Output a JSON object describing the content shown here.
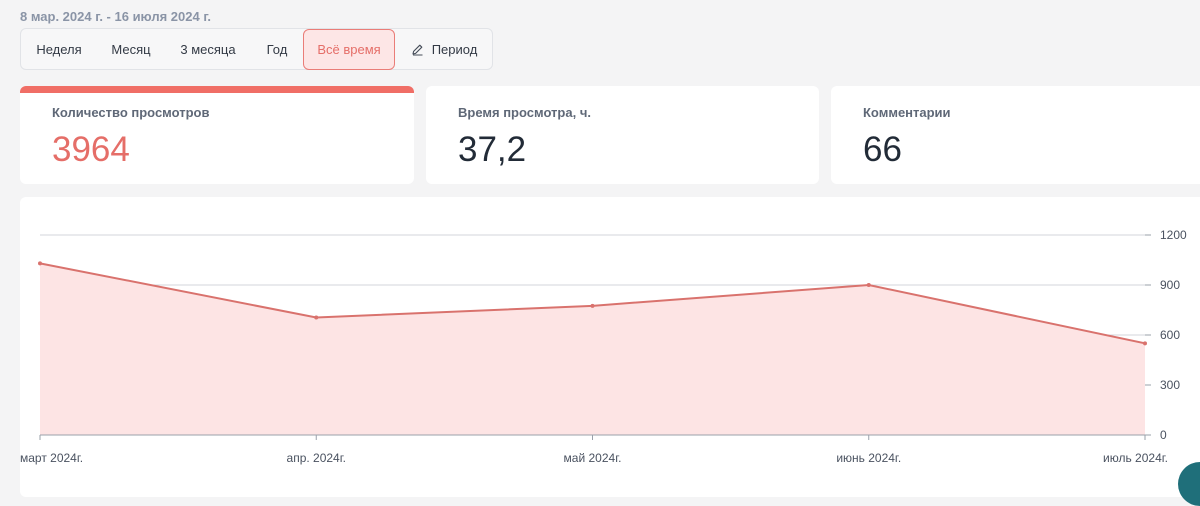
{
  "date_range": "8 мар. 2024 г. - 16 июля 2024 г.",
  "periods": [
    {
      "label": "Неделя",
      "active": false
    },
    {
      "label": "Месяц",
      "active": false
    },
    {
      "label": "3 месяца",
      "active": false
    },
    {
      "label": "Год",
      "active": false
    },
    {
      "label": "Всё время",
      "active": true
    },
    {
      "label": "Период",
      "active": false,
      "icon": "pencil-icon"
    }
  ],
  "metrics": [
    {
      "label": "Количество просмотров",
      "value": "3964",
      "selected": true
    },
    {
      "label": "Время просмотра, ч.",
      "value": "37,2",
      "selected": false
    },
    {
      "label": "Комментарии",
      "value": "66",
      "selected": false
    }
  ],
  "colors": {
    "accent": "#e56e68",
    "line": "#d9726d",
    "fill": "#fde4e4",
    "grid": "#d3d6db",
    "text": "#222b37"
  },
  "chart_data": {
    "type": "area",
    "categories": [
      "март 2024г.",
      "апр. 2024г.",
      "май 2024г.",
      "июнь 2024г.",
      "июль 2024г."
    ],
    "values": [
      1030,
      705,
      775,
      900,
      550
    ],
    "yticks": [
      0,
      300,
      600,
      900,
      1200
    ],
    "ylim": [
      0,
      1200
    ],
    "grid": true,
    "y_axis_side": "right"
  }
}
